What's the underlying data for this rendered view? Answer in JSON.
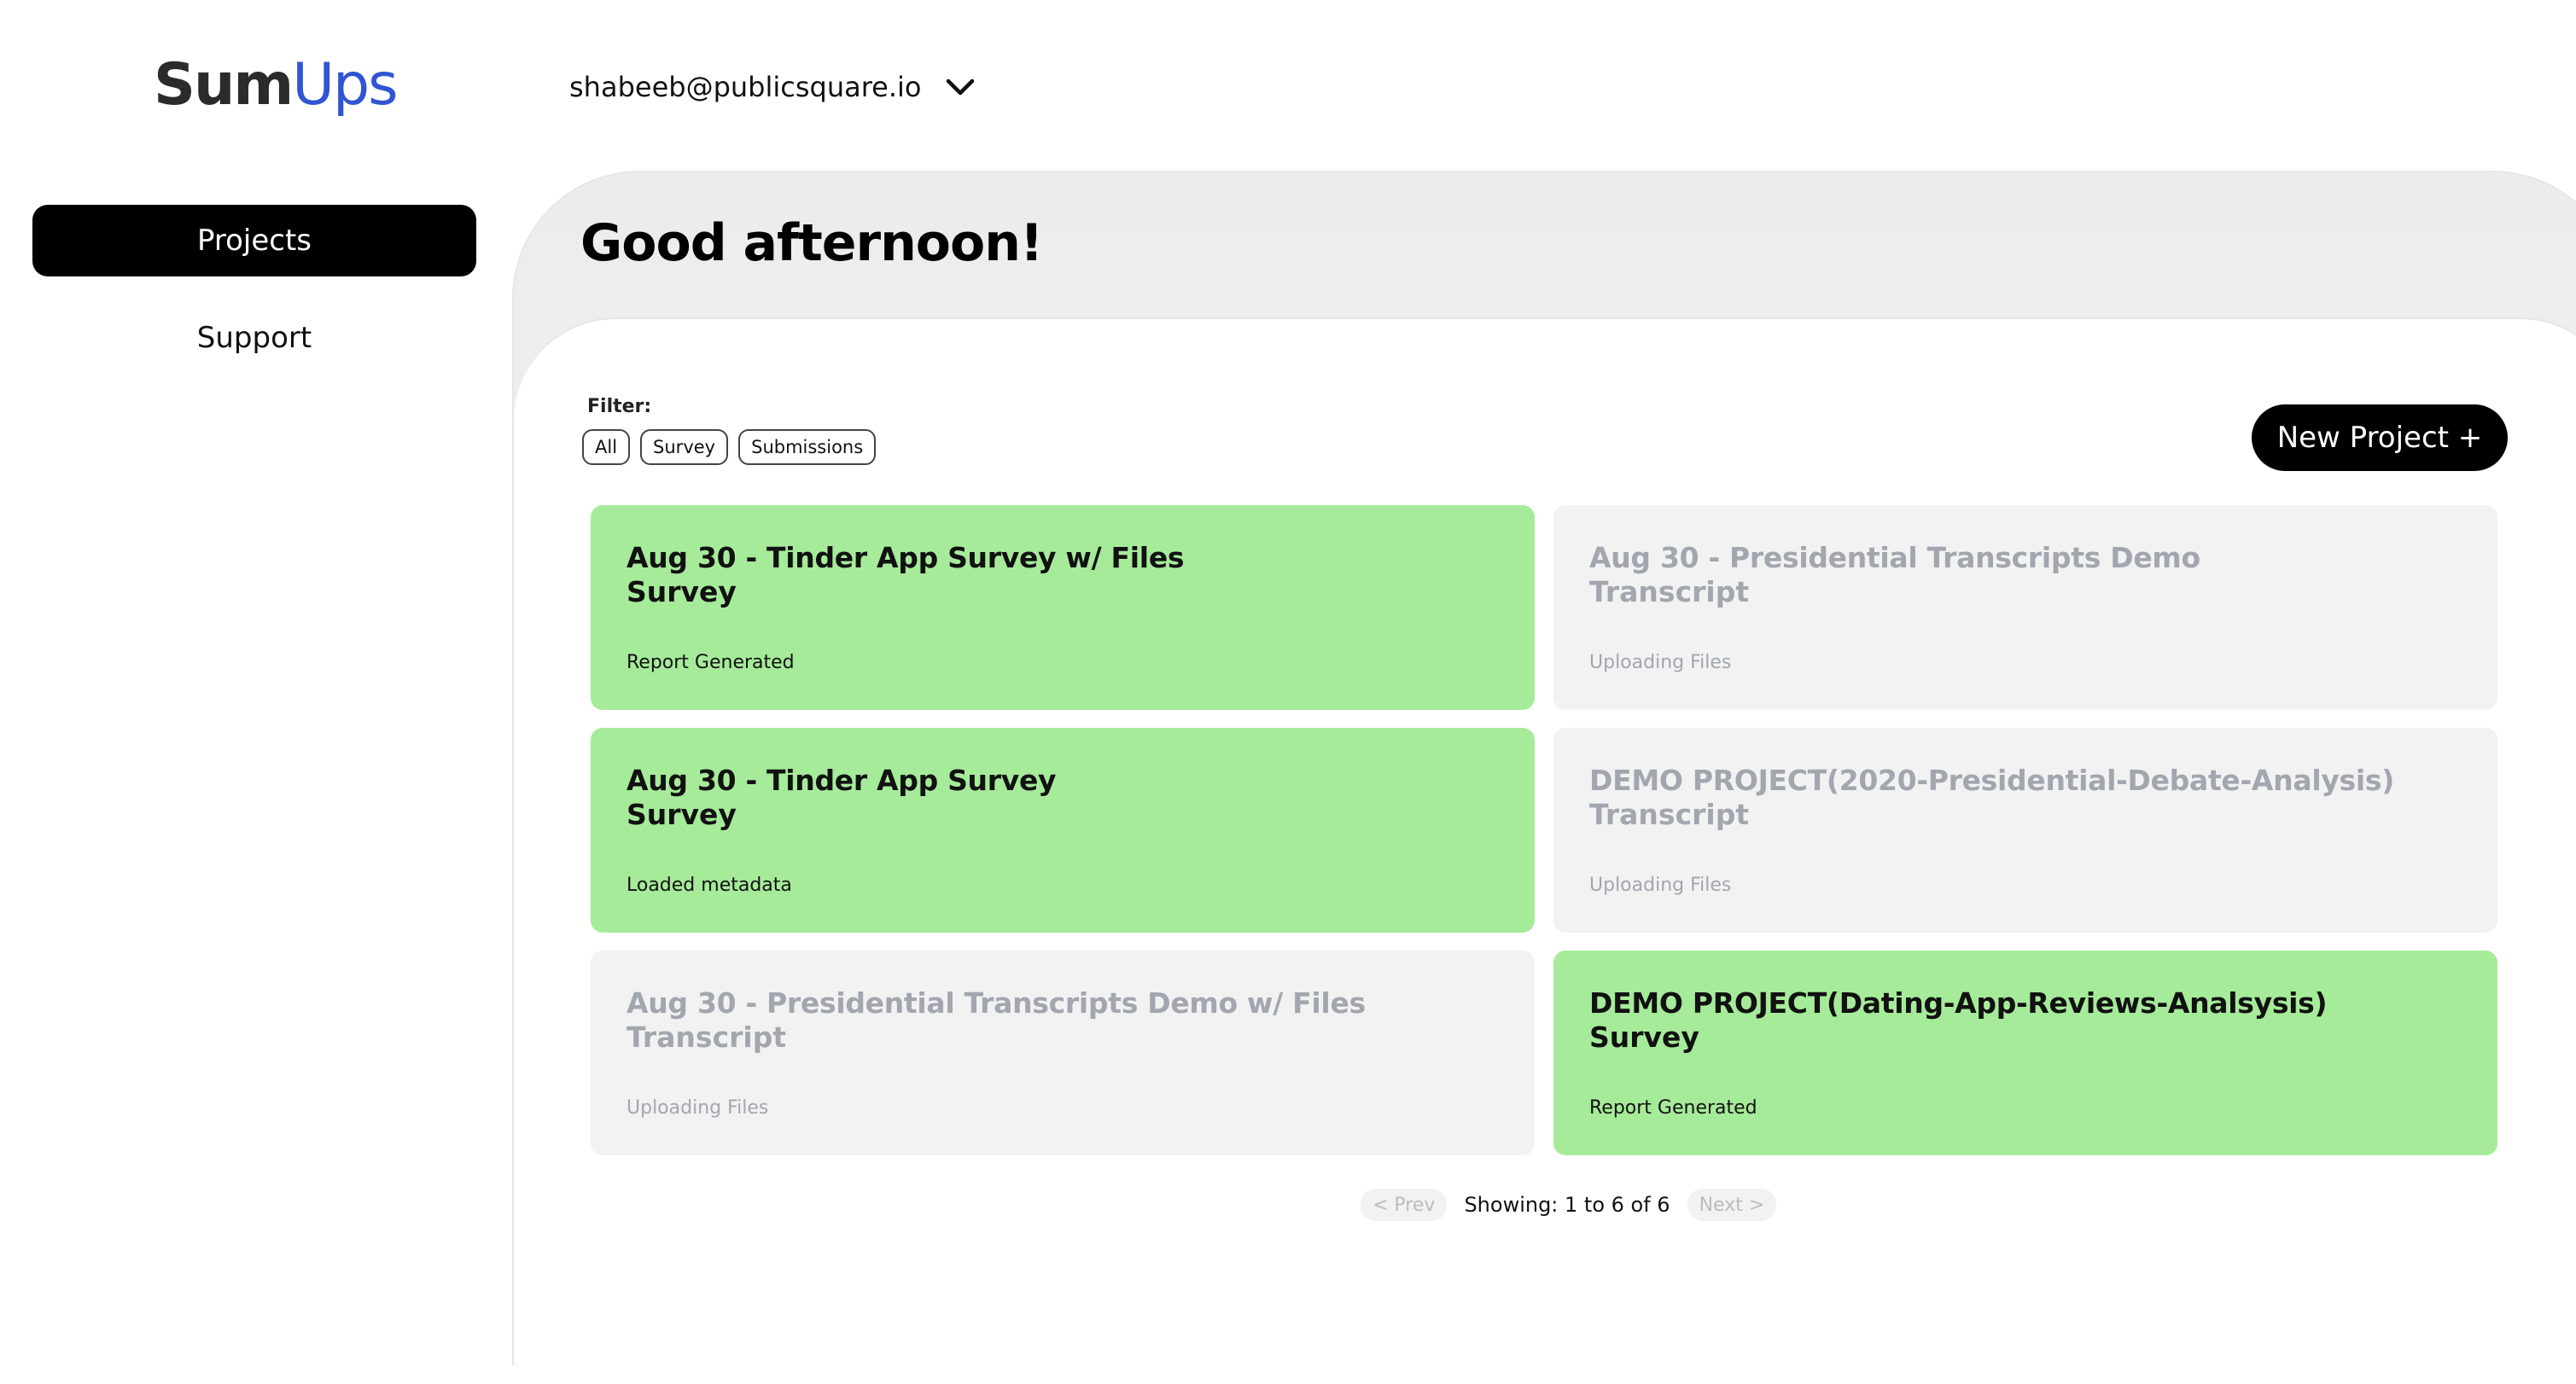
{
  "brand": {
    "part1": "Sum",
    "part2": "Ups"
  },
  "account": {
    "email": "shabeeb@publicsquare.io"
  },
  "sidebar": {
    "items": [
      {
        "label": "Projects",
        "active": true
      },
      {
        "label": "Support",
        "active": false
      }
    ]
  },
  "greeting": "Good afternoon!",
  "filter": {
    "label": "Filter:",
    "options": [
      "All",
      "Survey",
      "Submissions"
    ]
  },
  "new_project_label": "New Project +",
  "projects": [
    {
      "title": "Aug 30 - Tinder App Survey w/ Files",
      "type": "Survey",
      "status": "Report Generated",
      "state": "ready"
    },
    {
      "title": "Aug 30 - Presidential Transcripts Demo",
      "type": "Transcript",
      "status": "Uploading Files",
      "state": "pending"
    },
    {
      "title": "Aug 30 - Tinder App Survey",
      "type": "Survey",
      "status": "Loaded metadata",
      "state": "ready"
    },
    {
      "title": "DEMO PROJECT(2020-Presidential-Debate-Analysis)",
      "type": "Transcript",
      "status": "Uploading Files",
      "state": "pending"
    },
    {
      "title": "Aug 30 - Presidential Transcripts Demo w/ Files",
      "type": "Transcript",
      "status": "Uploading Files",
      "state": "pending"
    },
    {
      "title": "DEMO PROJECT(Dating-App-Reviews-Analsysis)",
      "type": "Survey",
      "status": "Report Generated",
      "state": "ready"
    }
  ],
  "pagination": {
    "prev_label": "< Prev",
    "showing": "Showing: 1 to 6 of 6",
    "next_label": "Next >"
  },
  "colors": {
    "ready_card": "#a6eb9a",
    "pending_card": "#f2f2f3",
    "brand_blue": "#2f55d4"
  }
}
